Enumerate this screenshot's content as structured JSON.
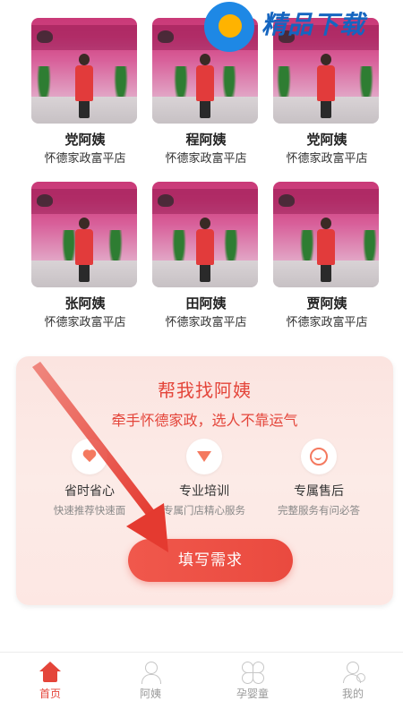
{
  "watermark": {
    "text": "精品下载"
  },
  "workers": [
    {
      "name": "党阿姨",
      "shop": "怀德家政富平店"
    },
    {
      "name": "程阿姨",
      "shop": "怀德家政富平店"
    },
    {
      "name": "党阿姨",
      "shop": "怀德家政富平店"
    },
    {
      "name": "张阿姨",
      "shop": "怀德家政富平店"
    },
    {
      "name": "田阿姨",
      "shop": "怀德家政富平店"
    },
    {
      "name": "贾阿姨",
      "shop": "怀德家政富平店"
    }
  ],
  "help_panel": {
    "title": "帮我找阿姨",
    "subtitle": "牵手怀德家政，选人不靠运气",
    "features": [
      {
        "icon": "heart-icon",
        "title": "省时省心",
        "desc": "快速推荐快速面"
      },
      {
        "icon": "diamond-icon",
        "title": "专业培训",
        "desc": "专属门店精心服务"
      },
      {
        "icon": "smile-icon",
        "title": "专属售后",
        "desc": "完整服务有问必答"
      }
    ],
    "cta_label": "填写需求"
  },
  "tabbar": {
    "items": [
      {
        "label": "首页",
        "icon": "home-icon",
        "active": true
      },
      {
        "label": "阿姨",
        "icon": "nanny-icon",
        "active": false
      },
      {
        "label": "孕婴童",
        "icon": "clover-icon",
        "active": false
      },
      {
        "label": "我的",
        "icon": "profile-icon",
        "active": false
      }
    ]
  },
  "colors": {
    "accent": "#e4453a",
    "panel_bg": "#fbe4e0",
    "tab_inactive": "#9a9a9a"
  }
}
